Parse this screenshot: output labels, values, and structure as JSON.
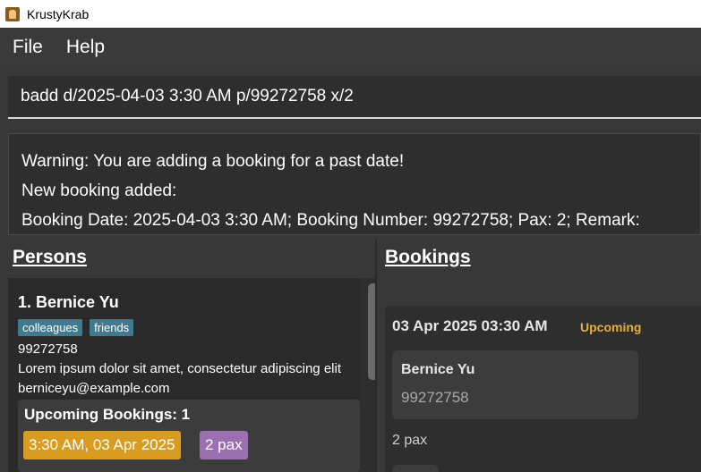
{
  "window": {
    "title": "KrustyKrab"
  },
  "menu": {
    "items": [
      "File",
      "Help"
    ]
  },
  "command": {
    "value": "badd d/2025-04-03 3:30 AM p/99272758 x/2"
  },
  "result": {
    "lines": [
      "Warning: You are adding a booking for a past date!",
      "New booking added:",
      "Booking Date: 2025-04-03 3:30 AM; Booking Number: 99272758; Pax: 2; Remark:"
    ]
  },
  "persons": {
    "header": "Persons",
    "items": [
      {
        "name": "1. Bernice Yu",
        "tags": [
          "colleagues",
          "friends"
        ],
        "phone": "99272758",
        "address": "Lorem ipsum dolor sit amet, consectetur adipiscing elit",
        "email": "berniceyu@example.com",
        "upcoming_label": "Upcoming Bookings:  1",
        "upcoming_time": "3:30 AM, 03 Apr 2025",
        "upcoming_pax": "2 pax"
      }
    ]
  },
  "bookings": {
    "header": "Bookings",
    "items": [
      {
        "date": "03 Apr 2025 03:30 AM",
        "status": "Upcoming",
        "person_name": "Bernice Yu",
        "person_phone": "99272758",
        "pax": "2 pax"
      }
    ]
  },
  "colors": {
    "tag": "#3e7b91",
    "time_pill": "#d89c20",
    "pax_pill": "#9b6fb0",
    "status_upcoming": "#e0b13b"
  }
}
